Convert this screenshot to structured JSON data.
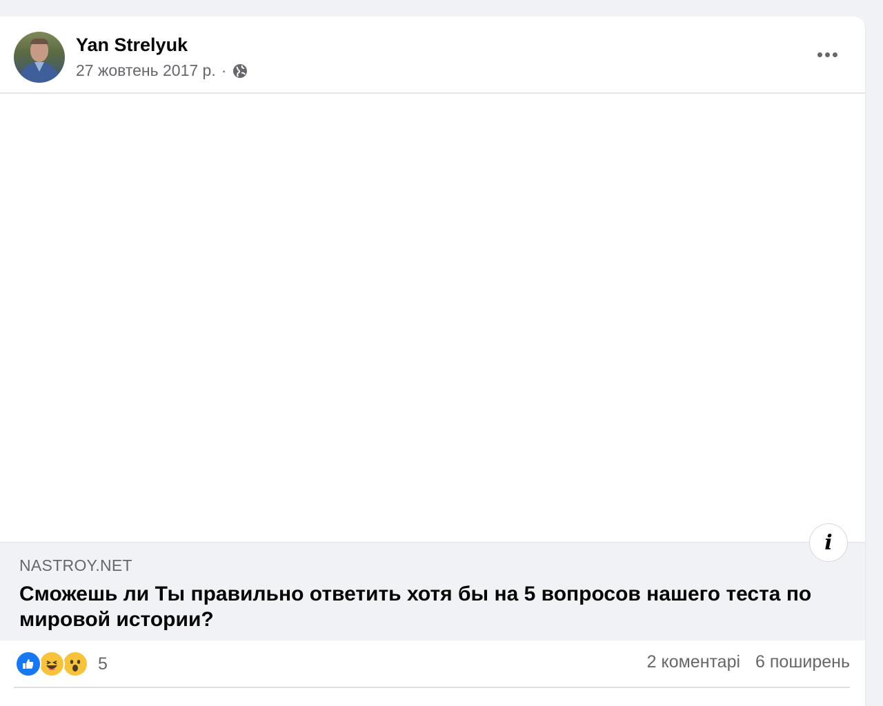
{
  "post": {
    "author": "Yan Strelyuk",
    "date": "27 жовтень 2017 р.",
    "separator": "·",
    "privacy_icon": "globe-icon",
    "more_icon": "more-options-icon"
  },
  "link_preview": {
    "domain": "NASTROY.NET",
    "title": "Сможешь ли Ты правильно ответить хотя бы на 5 вопросов нашего теста по мировой истории?",
    "info_label": "i"
  },
  "footer": {
    "reaction_icons": [
      "like-icon",
      "haha-icon",
      "wow-icon"
    ],
    "reaction_count": "5",
    "comments": "2 коментарі",
    "shares": "6 поширень"
  },
  "colors": {
    "background": "#f0f2f5",
    "card": "#ffffff",
    "text_primary": "#050505",
    "text_secondary": "#65676b",
    "like_blue": "#1877f2",
    "emoji_yellow": "#f7c33b"
  }
}
